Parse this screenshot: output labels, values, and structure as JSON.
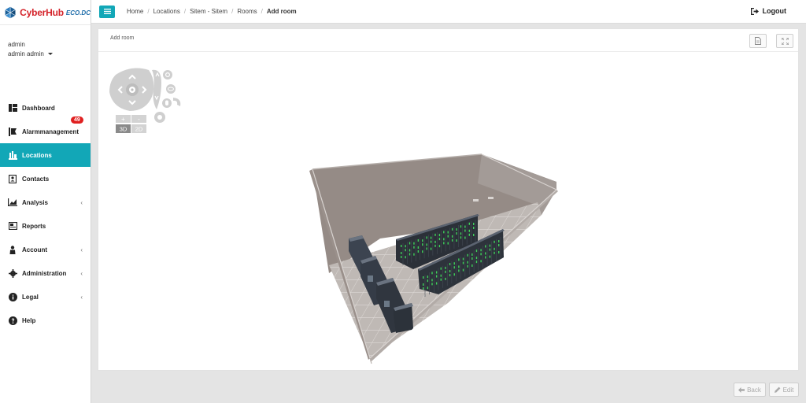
{
  "brand": {
    "name": "CyberHub",
    "suffix": "ECO.DC"
  },
  "user": {
    "username": "admin",
    "fullname": "admin admin"
  },
  "sidebar": {
    "items": [
      {
        "label": "Dashboard",
        "active": false
      },
      {
        "label": "Alarmmanagement",
        "badge": "49",
        "active": false
      },
      {
        "label": "Locations",
        "active": true
      },
      {
        "label": "Contacts",
        "active": false
      },
      {
        "label": "Analysis",
        "active": false
      },
      {
        "label": "Reports",
        "active": false
      },
      {
        "label": "Account",
        "active": false
      },
      {
        "label": "Administration",
        "active": false
      },
      {
        "label": "Legal",
        "active": false
      },
      {
        "label": "Help",
        "active": false
      }
    ]
  },
  "breadcrumb": [
    "Home",
    "Locations",
    "Sitem - Sitem",
    "Rooms",
    "Add room"
  ],
  "topbar": {
    "logout_label": "Logout"
  },
  "panel": {
    "title": "Add room"
  },
  "viewer_controls": {
    "zoom_in": "+",
    "zoom_out": "-",
    "mode_3d": "3D",
    "mode_2d": "2D"
  },
  "footer": {
    "back_label": "Back",
    "edit_label": "Edit"
  },
  "colors": {
    "accent": "#12a7b7",
    "brand_red": "#d4232a",
    "badge_red": "#e02020"
  }
}
